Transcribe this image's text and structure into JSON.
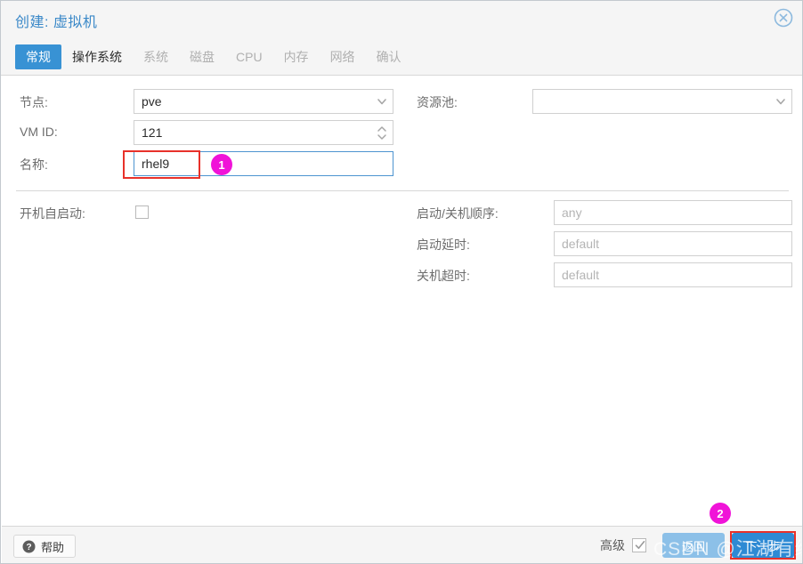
{
  "window": {
    "title": "创建: 虚拟机",
    "close_icon": "close-circle-icon"
  },
  "tabs": [
    {
      "label": "常规",
      "state": "active"
    },
    {
      "label": "操作系统",
      "state": "enabled"
    },
    {
      "label": "系统",
      "state": "disabled"
    },
    {
      "label": "磁盘",
      "state": "disabled"
    },
    {
      "label": "CPU",
      "state": "disabled"
    },
    {
      "label": "内存",
      "state": "disabled"
    },
    {
      "label": "网络",
      "state": "disabled"
    },
    {
      "label": "确认",
      "state": "disabled"
    }
  ],
  "form": {
    "left": {
      "node": {
        "label": "节点:",
        "value": "pve",
        "control": "combobox",
        "icon": "chevron-down-icon"
      },
      "vmid": {
        "label": "VM ID:",
        "value": "121",
        "control": "spinner",
        "icon": "spinner-arrows-icon"
      },
      "name": {
        "label": "名称:",
        "value": "rhel9",
        "control": "textfield",
        "focused": true
      },
      "onboot": {
        "label": "开机自启动:",
        "checked": false,
        "control": "checkbox"
      }
    },
    "right": {
      "pool": {
        "label": "资源池:",
        "value": "",
        "placeholder": "",
        "control": "combobox",
        "icon": "chevron-down-icon"
      },
      "startup_order": {
        "label": "启动/关机顺序:",
        "value": "",
        "placeholder": "any",
        "control": "textfield"
      },
      "startup_delay": {
        "label": "启动延时:",
        "value": "",
        "placeholder": "default",
        "control": "textfield"
      },
      "shutdown_to": {
        "label": "关机超时:",
        "value": "",
        "placeholder": "default",
        "control": "textfield"
      }
    }
  },
  "footer": {
    "help_label": "帮助",
    "help_icon": "question-circle-icon",
    "advanced_label": "高级",
    "advanced_checked": true,
    "back_label": "返回",
    "next_label": "下一步"
  },
  "annotations": {
    "badge1": "1",
    "badge2": "2"
  },
  "watermark": {
    "text": "CSDN @江湖有缘"
  },
  "colors": {
    "accent": "#3892d4",
    "next_button": "#2e8ad4",
    "back_button": "#8cc0e8",
    "annotation_red": "#e8312a",
    "annotation_magenta": "#f013d8",
    "title_blue": "#3a88c8"
  }
}
